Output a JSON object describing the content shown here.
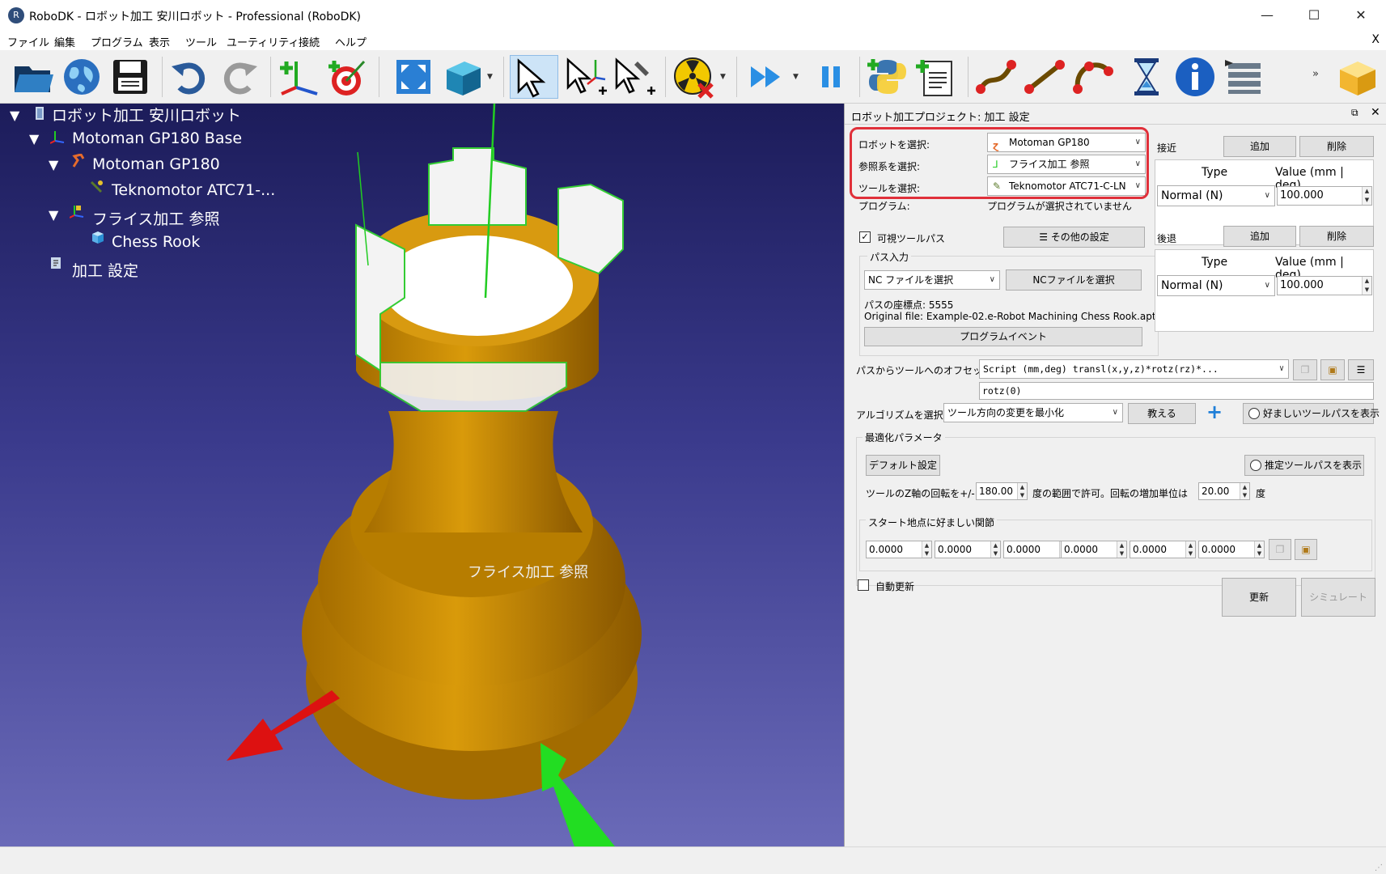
{
  "window": {
    "title": "RoboDK - ロボット加工 安川ロボット - Professional (RoboDK)",
    "minimize": "—",
    "maximize": "☐",
    "close": "✕"
  },
  "menu": {
    "items": [
      "ファイル",
      "編集",
      "プログラム",
      "表示",
      "ツール",
      "ユーティリティ",
      "接続",
      "ヘルプ"
    ],
    "close": "X"
  },
  "toolbar": {
    "icons": [
      "open-icon",
      "globe-icon",
      "save-icon",
      "undo-icon",
      "redo-icon",
      "add-reference-icon",
      "add-target-icon",
      "fit-all-icon",
      "view-box-icon",
      "select-icon",
      "move-reference-icon",
      "move-tool-icon",
      "collision-icon",
      "run-icon",
      "pause-icon",
      "python-icon",
      "add-program-icon",
      "joint-move-icon",
      "linear-move-icon",
      "circular-move-icon",
      "pause-hourglass-icon",
      "info-icon",
      "program-list-icon",
      "package-icon"
    ],
    "overflow": "»"
  },
  "tree": {
    "station": "ロボット加工 安川ロボット",
    "base": "Motoman GP180 Base",
    "robot": "Motoman GP180",
    "tool": "Teknomotor ATC71-...",
    "frame": "フライス加工 参照",
    "object": "Chess Rook",
    "project": "加工 設定"
  },
  "viewport": {
    "frame_label": "フライス加工 参照"
  },
  "panel": {
    "title": "ロボット加工プロジェクト: 加工 設定",
    "robot_label": "ロボットを選択:",
    "robot_value": "Motoman GP180",
    "frame_label": "参照系を選択:",
    "frame_value": "フライス加工 参照",
    "tool_label": "ツールを選択:",
    "tool_value": "Teknomotor ATC71-C-LN",
    "program_label": "プログラム:",
    "program_value": "プログラムが選択されていません",
    "visible_toolpath": "可視ツールパス",
    "other_settings": "その他の設定",
    "path_input": "パス入力",
    "nc_combo": "NC ファイルを選択",
    "nc_button": "NCファイルを選択",
    "path_points": "パスの座標点: 5555",
    "original_file": "Original file: Example-02.e-Robot Machining Chess Rook.apt",
    "program_events": "プログラムイベント",
    "approach": {
      "label": "接近",
      "add": "追加",
      "delete": "削除",
      "col_type": "Type",
      "col_value": "Value (mm | deg)",
      "row_type": "Normal (N)",
      "row_value": "100.000"
    },
    "retract": {
      "label": "後退",
      "add": "追加",
      "delete": "削除",
      "col_type": "Type",
      "col_value": "Value (mm | deg)",
      "row_type": "Normal (N)",
      "row_value": "100.000"
    },
    "offset_label": "パスからツールへのオフセット:",
    "offset_combo": "Script (mm,deg) transl(x,y,z)*rotz(rz)*...",
    "offset_value": "rotz(0)",
    "algorithm_label": "アルゴリズムを選択:",
    "algorithm_value": "ツール方向の変更を最小化",
    "teach": "教える",
    "show_preferred": "好ましいツールパスを表示",
    "opt_params": "最適化パラメータ",
    "default_settings": "デフォルト設定",
    "show_estimated": "推定ツールパスを表示",
    "rotation_prefix": "ツールのZ軸の回転を+/-",
    "rotation_value": "180.00",
    "rotation_mid": "度の範囲で許可。回転の増加単位は",
    "rotation_step": "20.00",
    "rotation_unit": "度",
    "start_joints_label": "スタート地点に好ましい関節",
    "joints": [
      "0.0000",
      "0.0000",
      "0.0000",
      "0.0000",
      "0.0000",
      "0.0000"
    ],
    "auto_update": "自動更新",
    "update": "更新",
    "simulate": "シミュレート"
  }
}
